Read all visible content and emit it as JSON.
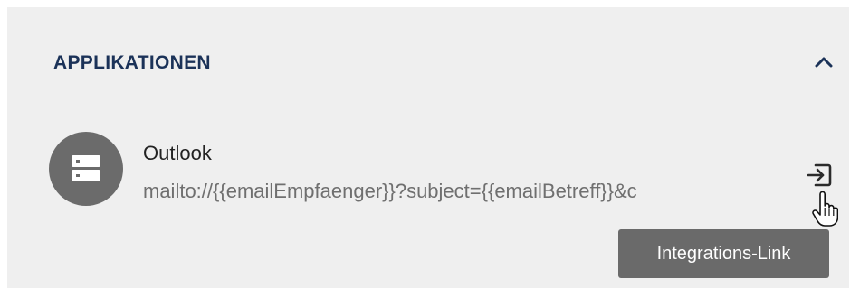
{
  "section": {
    "title": "APPLIKATIONEN",
    "collapse_icon": "chevron-up-icon"
  },
  "application": {
    "name": "Outlook",
    "url": "mailto://{{emailEmpfaenger}}?subject={{emailBetreff}}&c",
    "avatar_icon": "server-icon",
    "action_icon": "sign-in-icon"
  },
  "tooltip": {
    "text": "Integrations-Link"
  },
  "colors": {
    "panel_background": "#efefef",
    "title": "#1b3258",
    "avatar": "#6b6b6b",
    "tooltip_background": "#6a6a6a"
  }
}
